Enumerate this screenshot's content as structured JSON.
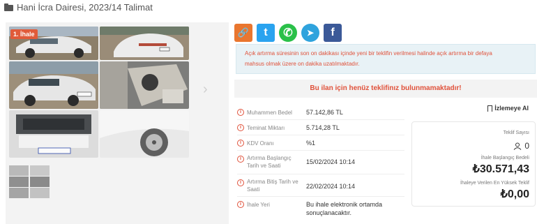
{
  "header": {
    "title": "Hani İcra Dairesi, 2023/14 Talimat",
    "icon": "folder-open-icon"
  },
  "gallery": {
    "badge": "1. İhale",
    "thumbnail_count": 6,
    "next_icon": "chevron-right-icon",
    "next_glyph": "›"
  },
  "share": {
    "link_icon": "link-icon",
    "link_glyph": "🔗",
    "twitter_icon": "twitter-icon",
    "twitter_glyph": "t",
    "whatsapp_icon": "whatsapp-icon",
    "whatsapp_glyph": "✆",
    "telegram_icon": "telegram-icon",
    "telegram_glyph": "➤",
    "facebook_icon": "facebook-icon",
    "facebook_glyph": "f"
  },
  "alert": {
    "line1": "Açık artırma süresinin son on dakikası içinde yeni bir teklifin verilmesi halinde açık artırma bir defaya",
    "line2": "mahsus olmak üzere on dakika uzatılmaktadır."
  },
  "no_offer": "Bu ilan için henüz teklifinız bulunmamaktadır!",
  "details": [
    {
      "label": "Muhammen Bedel",
      "value": "57.142,86 TL"
    },
    {
      "label": "Teminat Miktarı",
      "value": "5.714,28 TL"
    },
    {
      "label": "KDV Oranı",
      "value": "%1"
    },
    {
      "label": "Artırma Başlangıç Tarih ve Saati",
      "value": "15/02/2024 10:14"
    },
    {
      "label": "Artırma Bitiş Tarih ve Saati",
      "value": "22/02/2024 10:14"
    },
    {
      "label": "İhale Yeri",
      "value": "Bu ihale elektronik ortamda sonuçlanacaktır."
    }
  ],
  "watch_label": "İzlemeye Al",
  "summary": {
    "bid_count_label": "Teklif Sayısı",
    "bid_count": "0",
    "start_price_label": "İhale Başlangıç Bedeli",
    "start_price": "₺30.571,43",
    "highest_label": "İhaleye Verilen En Yüksek Teklif",
    "highest": "₺0,00"
  },
  "colors": {
    "accent_red": "#e0513a",
    "alert_bg": "#e8f2f6",
    "panel_bg": "#f3f3f3"
  }
}
